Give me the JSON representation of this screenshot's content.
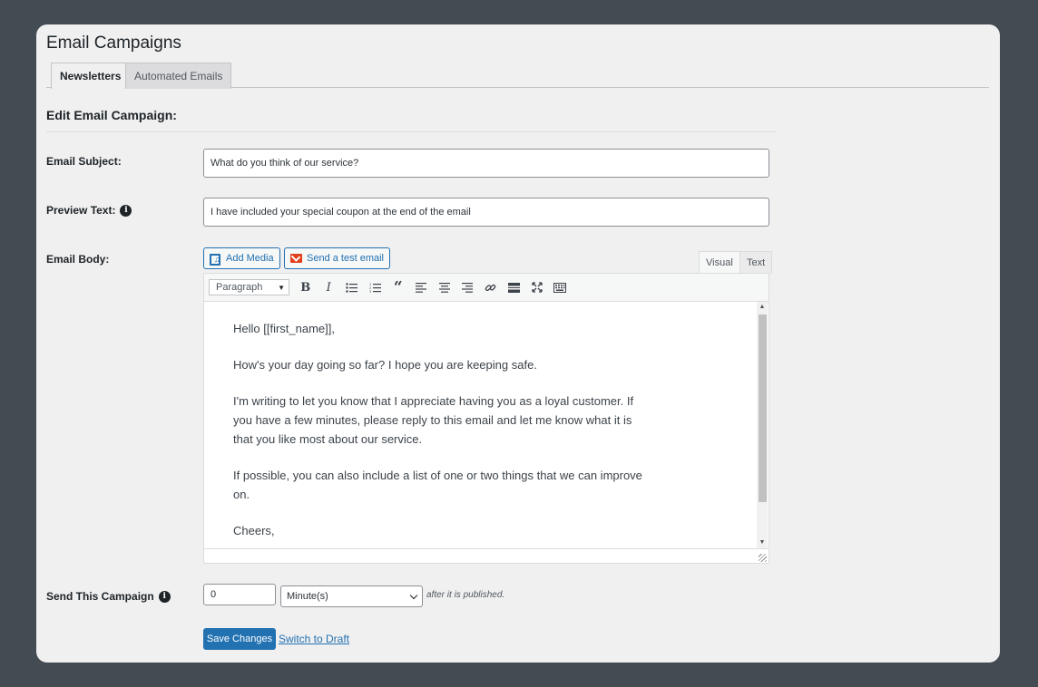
{
  "page": {
    "title": "Email Campaigns"
  },
  "tabs": [
    {
      "label": "Newsletters",
      "active": true
    },
    {
      "label": "Automated Emails",
      "active": false
    }
  ],
  "section": {
    "title": "Edit Email Campaign:"
  },
  "form": {
    "subject": {
      "label": "Email Subject:",
      "value": "What do you think of our service?"
    },
    "preview": {
      "label": "Preview Text:",
      "value": "I have included your special coupon at the end of the email"
    },
    "body": {
      "label": "Email Body:",
      "add_media": "Add Media",
      "send_test": "Send a test email",
      "tab_visual": "Visual",
      "tab_text": "Text",
      "format": "Paragraph",
      "paragraphs": [
        "Hello [[first_name]],",
        "How's your day going so far? I hope you are keeping safe.",
        "I'm writing to let you know that I appreciate having you as a loyal customer. If you have a few minutes, please reply to this email and let me know what it is that you like most about our service.",
        "If possible, you can also include a list of one or two things that we can improve on.",
        "Cheers,"
      ]
    },
    "send": {
      "label": "Send This Campaign",
      "amount": "0",
      "unit": "Minute(s)",
      "suffix": "after it is published."
    }
  },
  "actions": {
    "save": "Save Changes",
    "draft": "Switch to Draft"
  },
  "colors": {
    "accent": "#2271b1",
    "background": "#434b53",
    "panel": "#f0f0f1"
  }
}
